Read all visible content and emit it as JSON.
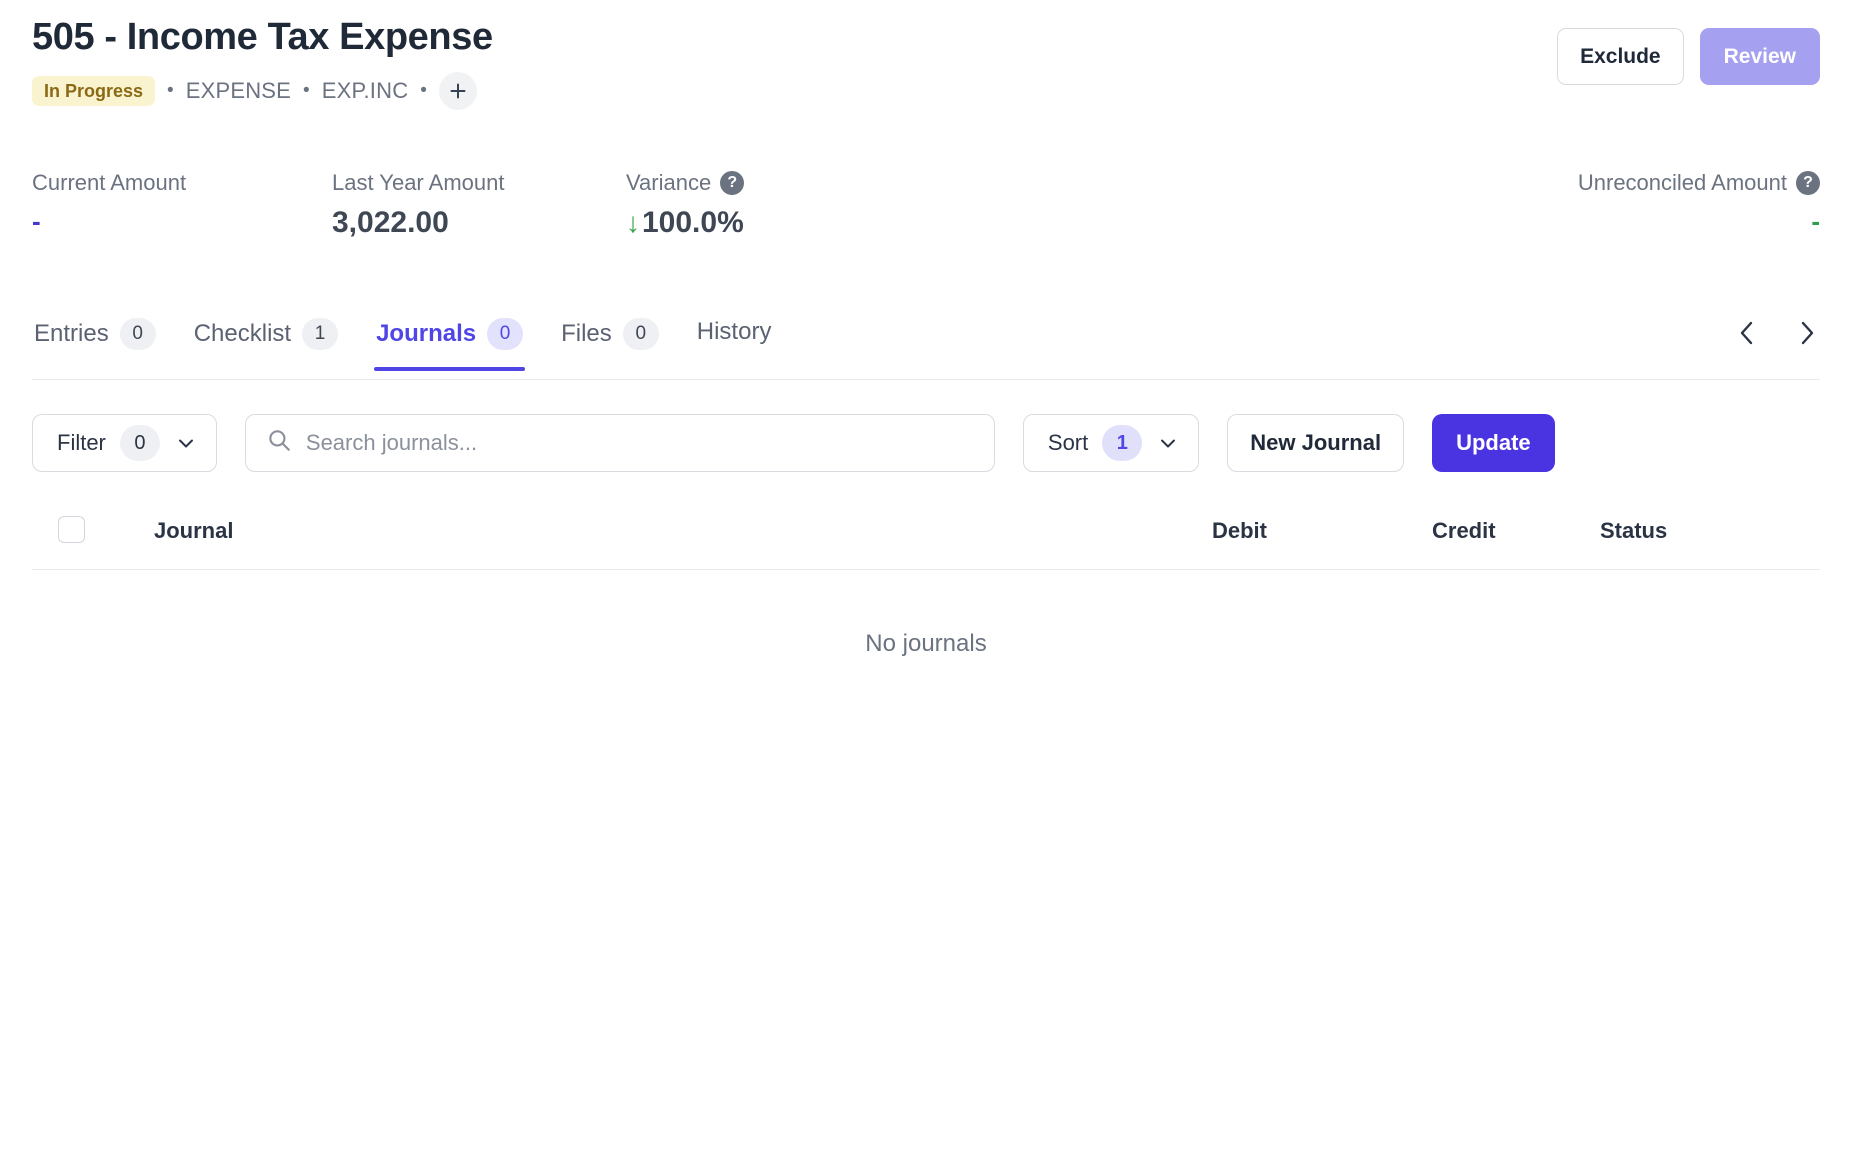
{
  "header": {
    "title": "505 - Income Tax Expense",
    "status_badge": "In Progress",
    "separator": "•",
    "meta_type": "EXPENSE",
    "meta_code": "EXP.INC",
    "add_tag_icon": "plus-icon",
    "exclude_label": "Exclude",
    "review_label": "Review",
    "review_color": "#A5A0F0"
  },
  "metrics": {
    "current": {
      "label": "Current Amount",
      "value": "-",
      "color": "#4338ca"
    },
    "last_year": {
      "label": "Last Year Amount",
      "value": "3,022.00",
      "color": "#3f4754"
    },
    "variance": {
      "label": "Variance",
      "help_icon": "question-mark-icon",
      "arrow": "↓",
      "value": "100.0%",
      "arrow_color": "#3aa34f"
    },
    "unreconciled": {
      "label": "Unreconciled Amount",
      "help_icon": "question-mark-icon",
      "value": "-",
      "color": "#2e9e4f"
    }
  },
  "tabs": {
    "items": [
      {
        "label": "Entries",
        "badge": "0",
        "active": false
      },
      {
        "label": "Checklist",
        "badge": "1",
        "active": false
      },
      {
        "label": "Journals",
        "badge": "0",
        "active": true
      },
      {
        "label": "Files",
        "badge": "0",
        "active": false
      },
      {
        "label": "History",
        "badge": null,
        "active": false
      }
    ],
    "prev_icon": "chevron-left-icon",
    "next_icon": "chevron-right-icon",
    "active_color": "#4f46e5"
  },
  "toolbar": {
    "filter_label": "Filter",
    "filter_count": "0",
    "search_placeholder": "Search journals...",
    "search_value": "",
    "search_icon": "search-icon",
    "sort_label": "Sort",
    "sort_count": "1",
    "new_journal_label": "New Journal",
    "update_label": "Update",
    "update_color": "#4a33e0"
  },
  "table": {
    "columns": {
      "journal": "Journal",
      "debit": "Debit",
      "credit": "Credit",
      "status": "Status"
    },
    "rows": [],
    "empty_message": "No journals"
  }
}
